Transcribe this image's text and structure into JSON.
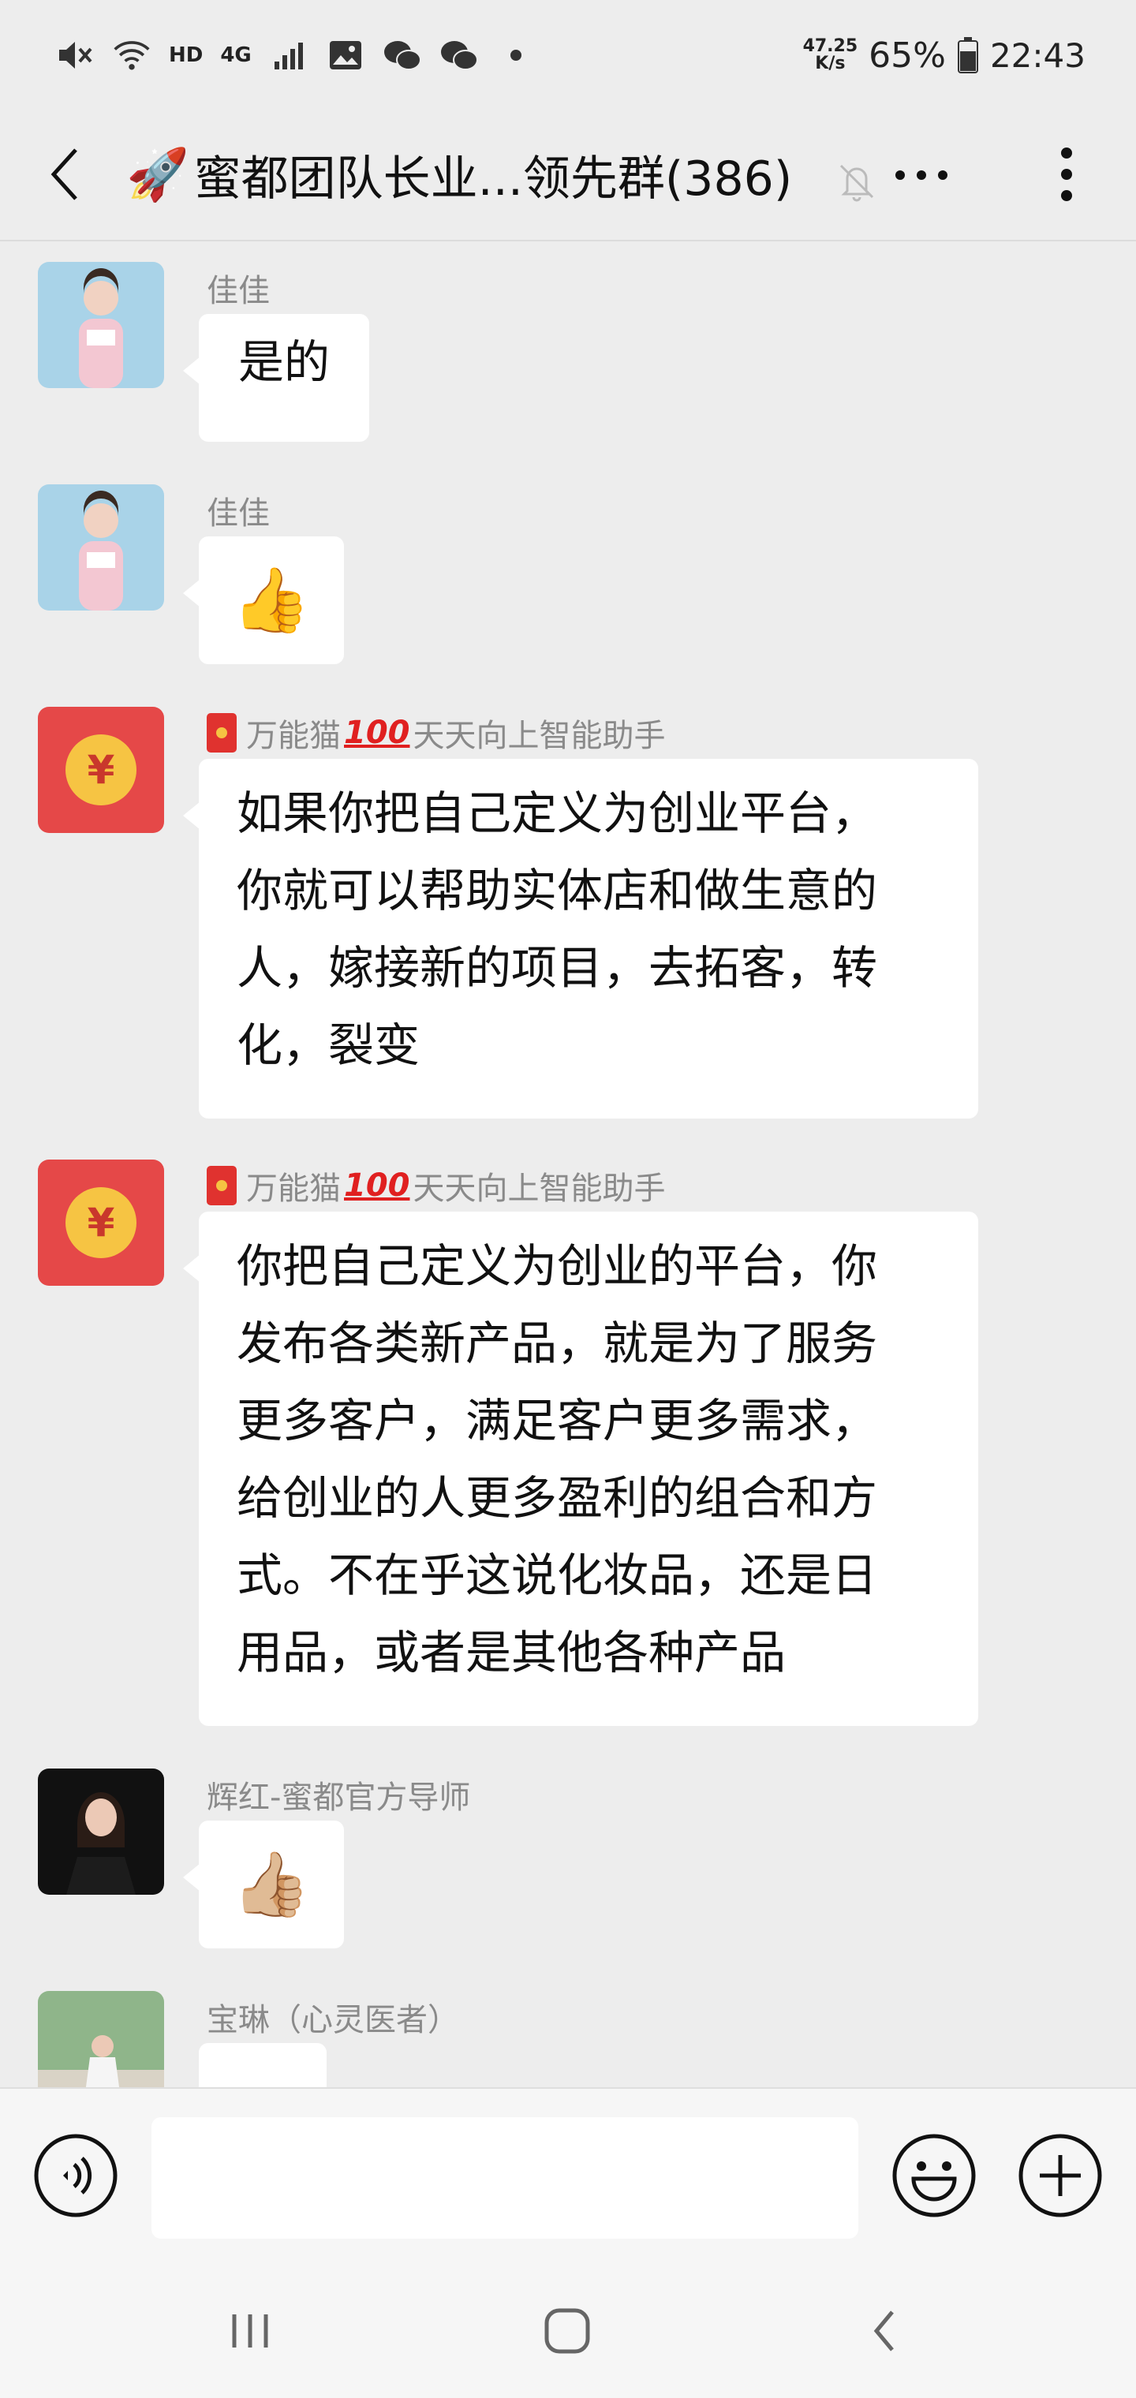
{
  "status_bar": {
    "hd_label": "HD",
    "network_label": "4G",
    "net_speed_value": "47.25",
    "net_speed_unit": "K/s",
    "battery": "65%",
    "time": "22:43"
  },
  "header": {
    "title": "蜜都团队长业...领先群(386)",
    "title_emoji": "🚀",
    "ellipsis": "···"
  },
  "messages": [
    {
      "sender": "佳佳",
      "text": "是的"
    },
    {
      "sender": "佳佳",
      "emoji": "👍"
    },
    {
      "sender_prefix": "万能猫",
      "sender_badge": "100",
      "sender_suffix": "天天向上智能助手",
      "lines": [
        "如果你把自己定义为创业平台，",
        "你就可以帮助实体店和做生意的",
        "人，嫁接新的项目，去拓客，转",
        "化，裂变"
      ]
    },
    {
      "sender_prefix": "万能猫",
      "sender_badge": "100",
      "sender_suffix": "天天向上智能助手",
      "lines": [
        "你把自己定义为创业的平台，你",
        "发布各类新产品，就是为了服务",
        "更多客户，满足客户更多需求，",
        "给创业的人更多盈利的组合和方",
        "式。不在乎这说化妆品，还是日",
        "用品，或者是其他各种产品"
      ]
    },
    {
      "sender": "辉红-蜜都官方导师",
      "emoji": "👍🏼"
    },
    {
      "sender": "宝琳（心灵医者）"
    }
  ],
  "input": {
    "value": "",
    "placeholder": ""
  },
  "colors": {
    "background": "#ededed",
    "bubble": "#ffffff",
    "red_packet": "#e54848",
    "coin": "#f6c443"
  }
}
